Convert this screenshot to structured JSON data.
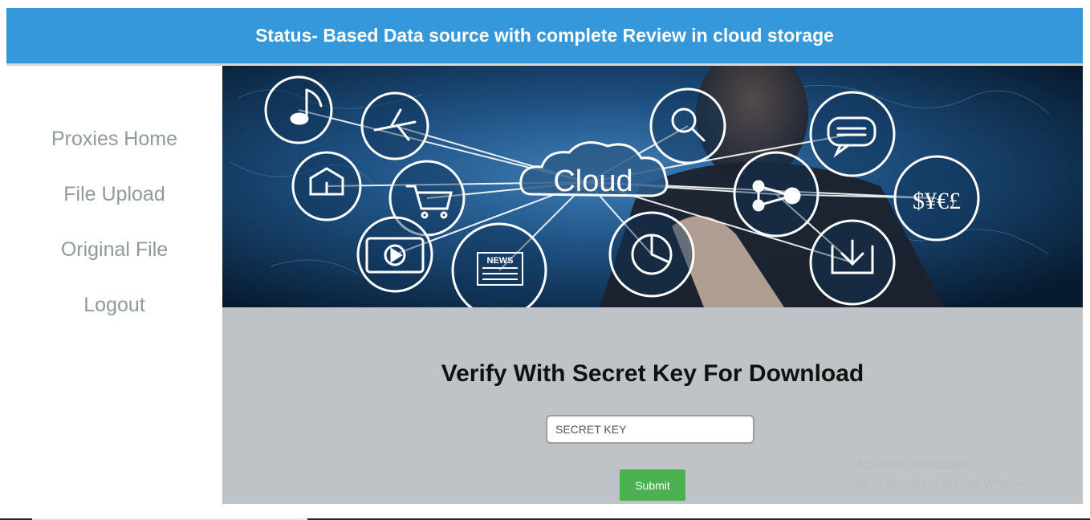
{
  "header": {
    "title": "Status- Based Data source with complete Review in cloud storage"
  },
  "sidebar": {
    "items": [
      {
        "label": "Proxies Home"
      },
      {
        "label": "File Upload"
      },
      {
        "label": "Original File"
      },
      {
        "label": "Logout"
      }
    ]
  },
  "banner": {
    "cloud_label": "Cloud",
    "news_label": "NEWS",
    "currency_label": "$¥€£",
    "icons": [
      "music-icon",
      "airplane-icon",
      "search-icon",
      "chat-icon",
      "home-icon",
      "cart-icon",
      "share-icon",
      "currency-icon",
      "video-icon",
      "news-icon",
      "pie-chart-icon",
      "download-icon"
    ]
  },
  "verify": {
    "title": "Verify With Secret Key For Download",
    "input_placeholder": "SECRET KEY",
    "input_value": "",
    "submit_label": "Submit"
  },
  "watermark": {
    "title": "Activate Windows",
    "subtitle": "Go to Settings to activate Windows."
  },
  "colors": {
    "header_bg": "#3498db",
    "panel_bg": "#bdc3c7",
    "nav_text": "#8f9a9e",
    "submit_bg": "#4caf50"
  }
}
